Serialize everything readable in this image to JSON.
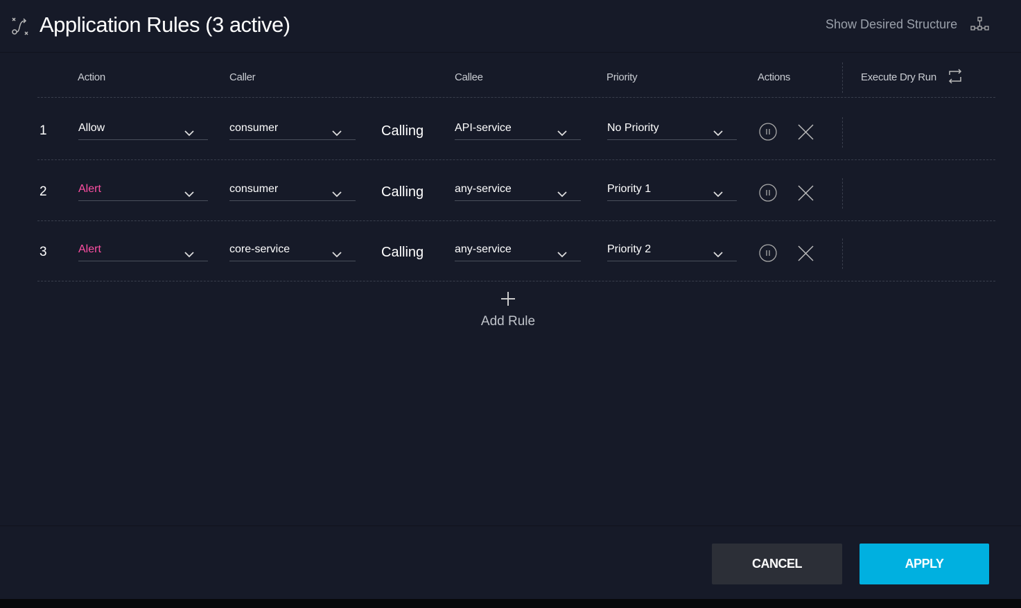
{
  "header": {
    "title": "Application Rules (3 active)",
    "show_structure": "Show Desired Structure"
  },
  "columns": {
    "action": "Action",
    "caller": "Caller",
    "callee": "Callee",
    "priority": "Priority",
    "actions": "Actions",
    "dry_run": "Execute Dry Run"
  },
  "rules": [
    {
      "num": "1",
      "action": "Allow",
      "action_color": "#ffffff",
      "caller": "consumer",
      "verb": "Calling",
      "callee": "API-service",
      "priority": "No Priority"
    },
    {
      "num": "2",
      "action": "Alert",
      "action_color": "#ff4fa3",
      "caller": "consumer",
      "verb": "Calling",
      "callee": "any-service",
      "priority": "Priority 1"
    },
    {
      "num": "3",
      "action": "Alert",
      "action_color": "#ff4fa3",
      "caller": "core-service",
      "verb": "Calling",
      "callee": "any-service",
      "priority": "Priority 2"
    }
  ],
  "add_rule": "Add Rule",
  "footer": {
    "cancel": "CANCEL",
    "apply": "APPLY",
    "apply_color": "#00b0e0"
  }
}
